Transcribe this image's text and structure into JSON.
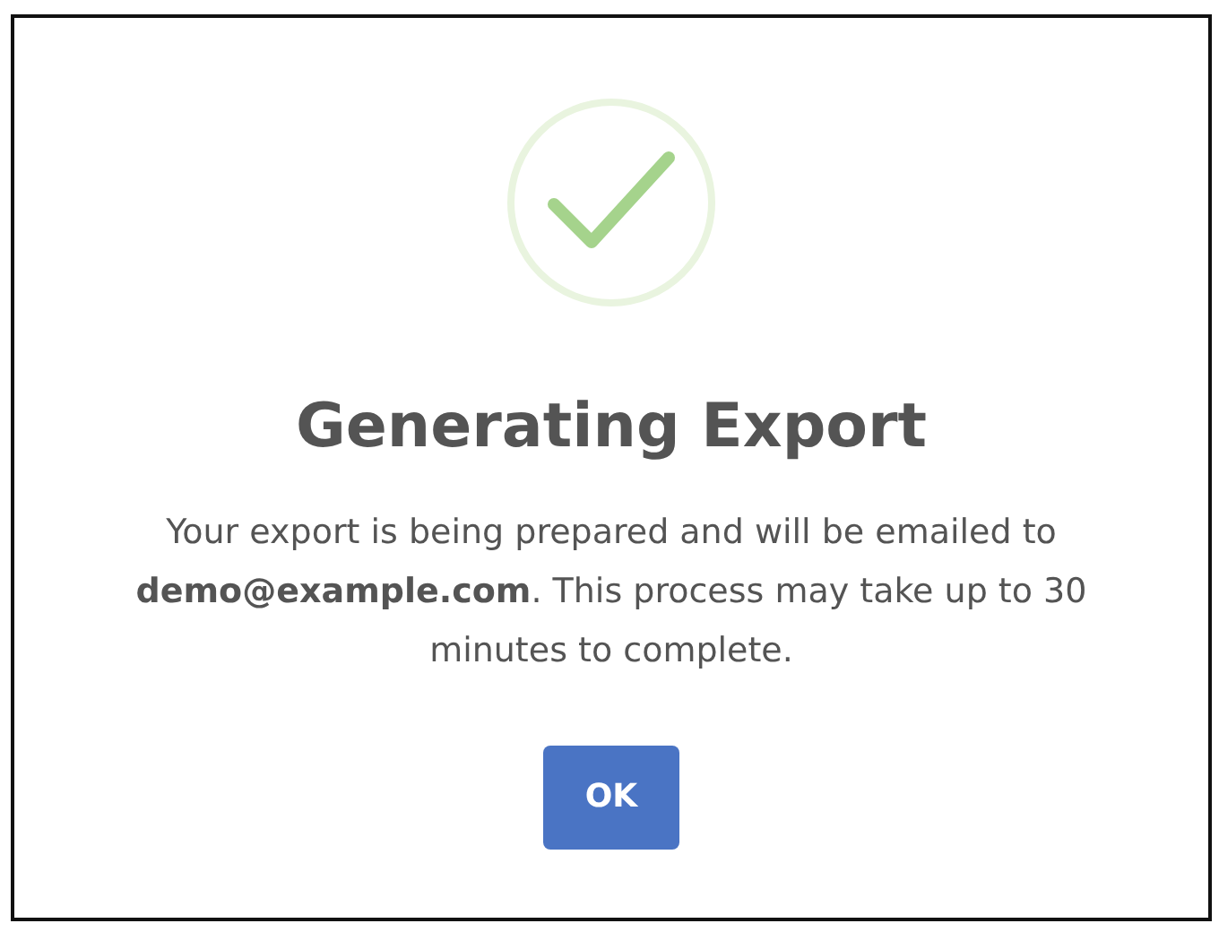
{
  "dialog": {
    "kind": "success",
    "title": "Generating Export",
    "message": "Your export is being prepared and will be emailed to **demo@example.com**. This process may take up to 30 minutes to complete.",
    "buttons": [
      "OK"
    ]
  }
}
